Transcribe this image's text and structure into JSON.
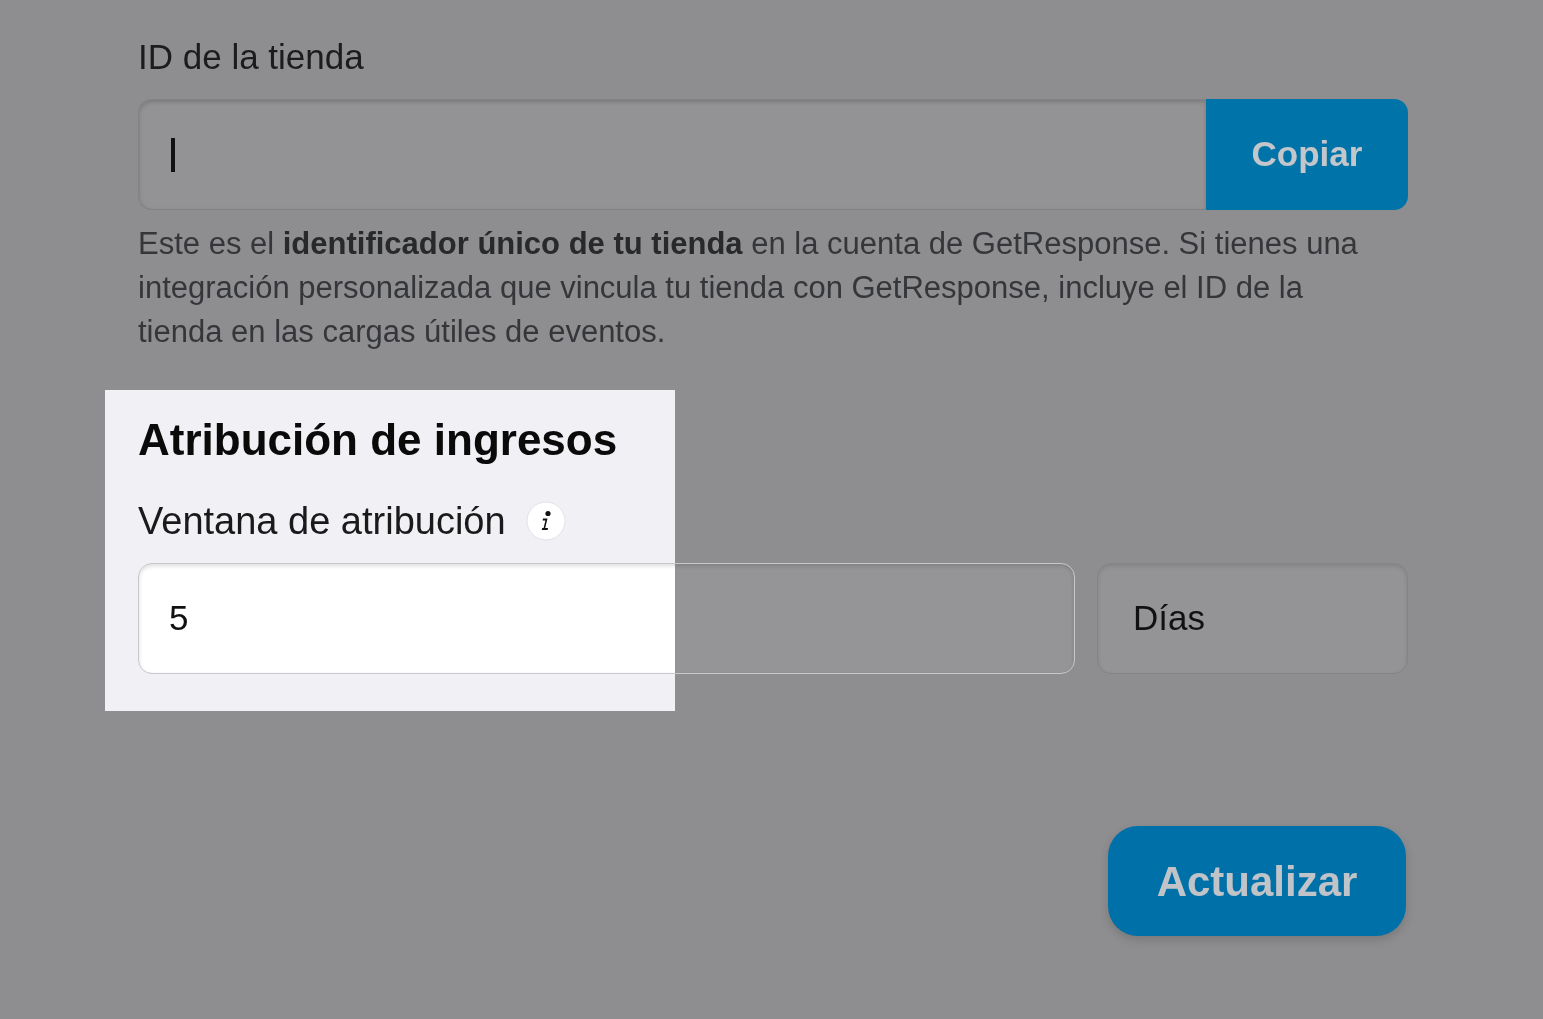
{
  "store_id": {
    "label": "ID de la tienda",
    "focused": true,
    "button": "Copiar",
    "help": "Este es el **identificador único de tu tienda** en la cuenta de GetResponse. Si tienes una integración personalizada que vincula tu tienda con GetResponse, incluye el ID de la tienda en las cargas útiles de eventos."
  },
  "revenue_attribution": {
    "title": "Atribución de ingresos",
    "highlighted": true,
    "window": {
      "label": "Ventana de atribución",
      "value": "5",
      "unit": "Días"
    }
  },
  "buttons": [
    {
      "label": "Actualizar"
    }
  ]
}
